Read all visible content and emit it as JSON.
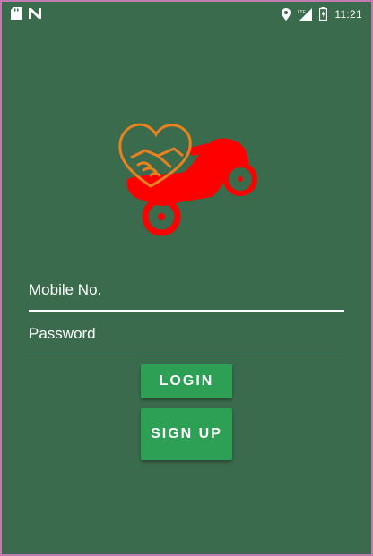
{
  "status_bar": {
    "time": "11:21",
    "icons": [
      "sd-card-icon",
      "n-notification-icon",
      "location-icon",
      "lte-signal-icon",
      "battery-charging-icon"
    ]
  },
  "logo": {
    "name": "handshake-heart-scooter-logo",
    "colors": {
      "heart": "#e8821e",
      "scooter": "#ff0000"
    }
  },
  "form": {
    "mobile_placeholder": "Mobile No.",
    "password_placeholder": "Password",
    "login_label": "LOGIN",
    "signup_label": "SIGN UP"
  },
  "colors": {
    "background": "#3b6b4d",
    "button": "#2ea055"
  }
}
